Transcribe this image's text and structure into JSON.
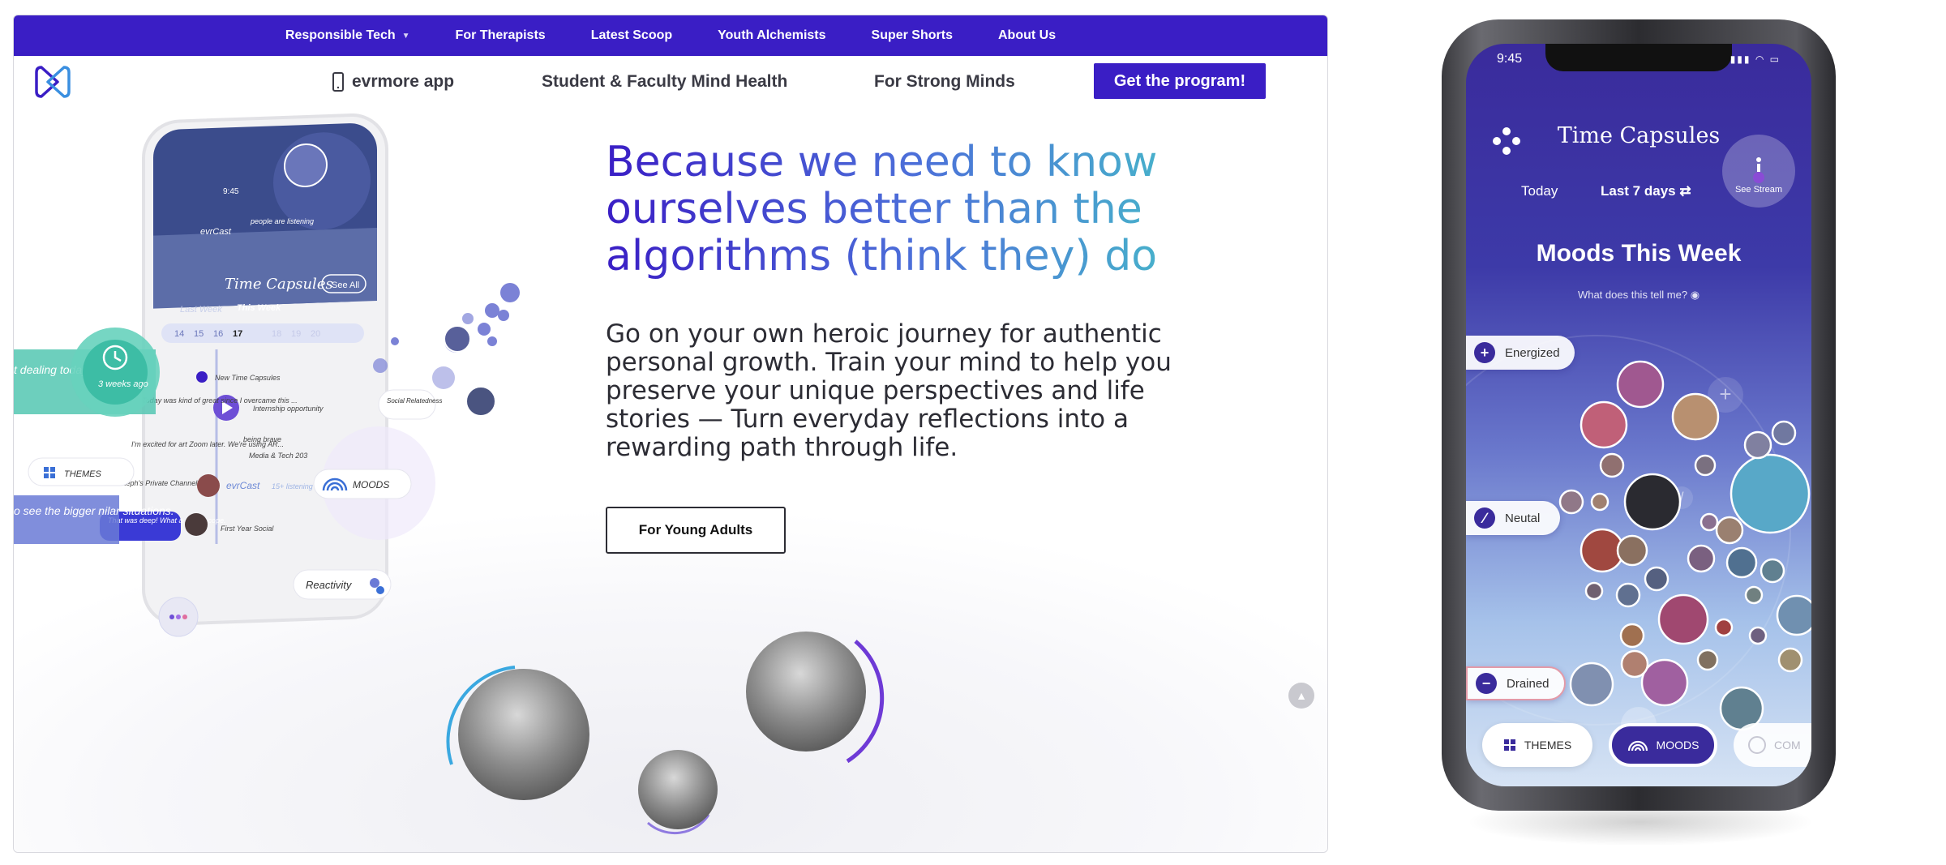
{
  "topbar": {
    "items": [
      {
        "label": "Responsible Tech"
      },
      {
        "label": "For Therapists"
      },
      {
        "label": "Latest Scoop"
      },
      {
        "label": "Youth Alchemists"
      },
      {
        "label": "Super Shorts"
      },
      {
        "label": "About Us"
      }
    ]
  },
  "mainnav": {
    "app_label": "evrmore app",
    "student_label": "Student & Faculty Mind Health",
    "minds_label": "For Strong Minds",
    "cta_label": "Get the program!"
  },
  "hero": {
    "headline": "Because we need to know ourselves better than the algorithms (think they) do",
    "subtext": "Go on your own heroic journey for authentic personal growth. Train your mind to help you preserve your unique perspectives and life stories — Turn everyday reflections into a rewarding path through life.",
    "button_label": "For Young Adults"
  },
  "illustration": {
    "app_title": "Time Capsules",
    "see_all": "See All",
    "last_week": "Last Week",
    "this_week": "This Week",
    "dates": [
      "14",
      "15",
      "16",
      "17",
      "18",
      "19",
      "20"
    ],
    "timer_label": "3 weeks ago",
    "dealing_text": "t dealing today ...",
    "themes_label": "THEMES",
    "bigger_text": "o see the bigger nilar situations.",
    "moods_label": "MOODS",
    "reactivity_label": "Reactivity",
    "social_label": "Social Relatedness",
    "evrcast_label": "evrCast",
    "listening": "15+ listening",
    "new_caps": "New Time Capsules",
    "note1": "Today was kind of great since I overcame this ...",
    "note2": "I'm excited for art Zoom later. We're using AR...",
    "note3": "Steph's Private Channel",
    "note4": "That was deep! What a way to cope.",
    "tag1": "Internship opportunity",
    "tag2": "being brave",
    "tag3": "Media & Tech 203",
    "tag4": "First Year Social",
    "people_listening": "people are listening",
    "time": "9:45"
  },
  "phone": {
    "time": "9:45",
    "title": "Time Capsules",
    "stream": "See Stream",
    "today": "Today",
    "range": "Last 7 days",
    "moods_title": "Moods This Week",
    "question": "What does this tell me?",
    "moods": [
      {
        "label": "Energized",
        "icon": "+"
      },
      {
        "label": "Neutal",
        "icon": "∕"
      },
      {
        "label": "Drained",
        "icon": "−"
      }
    ],
    "tabs": [
      {
        "label": "THEMES"
      },
      {
        "label": "MOODS"
      },
      {
        "label": "COM"
      }
    ]
  },
  "colors": {
    "brand": "#3a1ec5",
    "teal": "#46c0c8"
  }
}
